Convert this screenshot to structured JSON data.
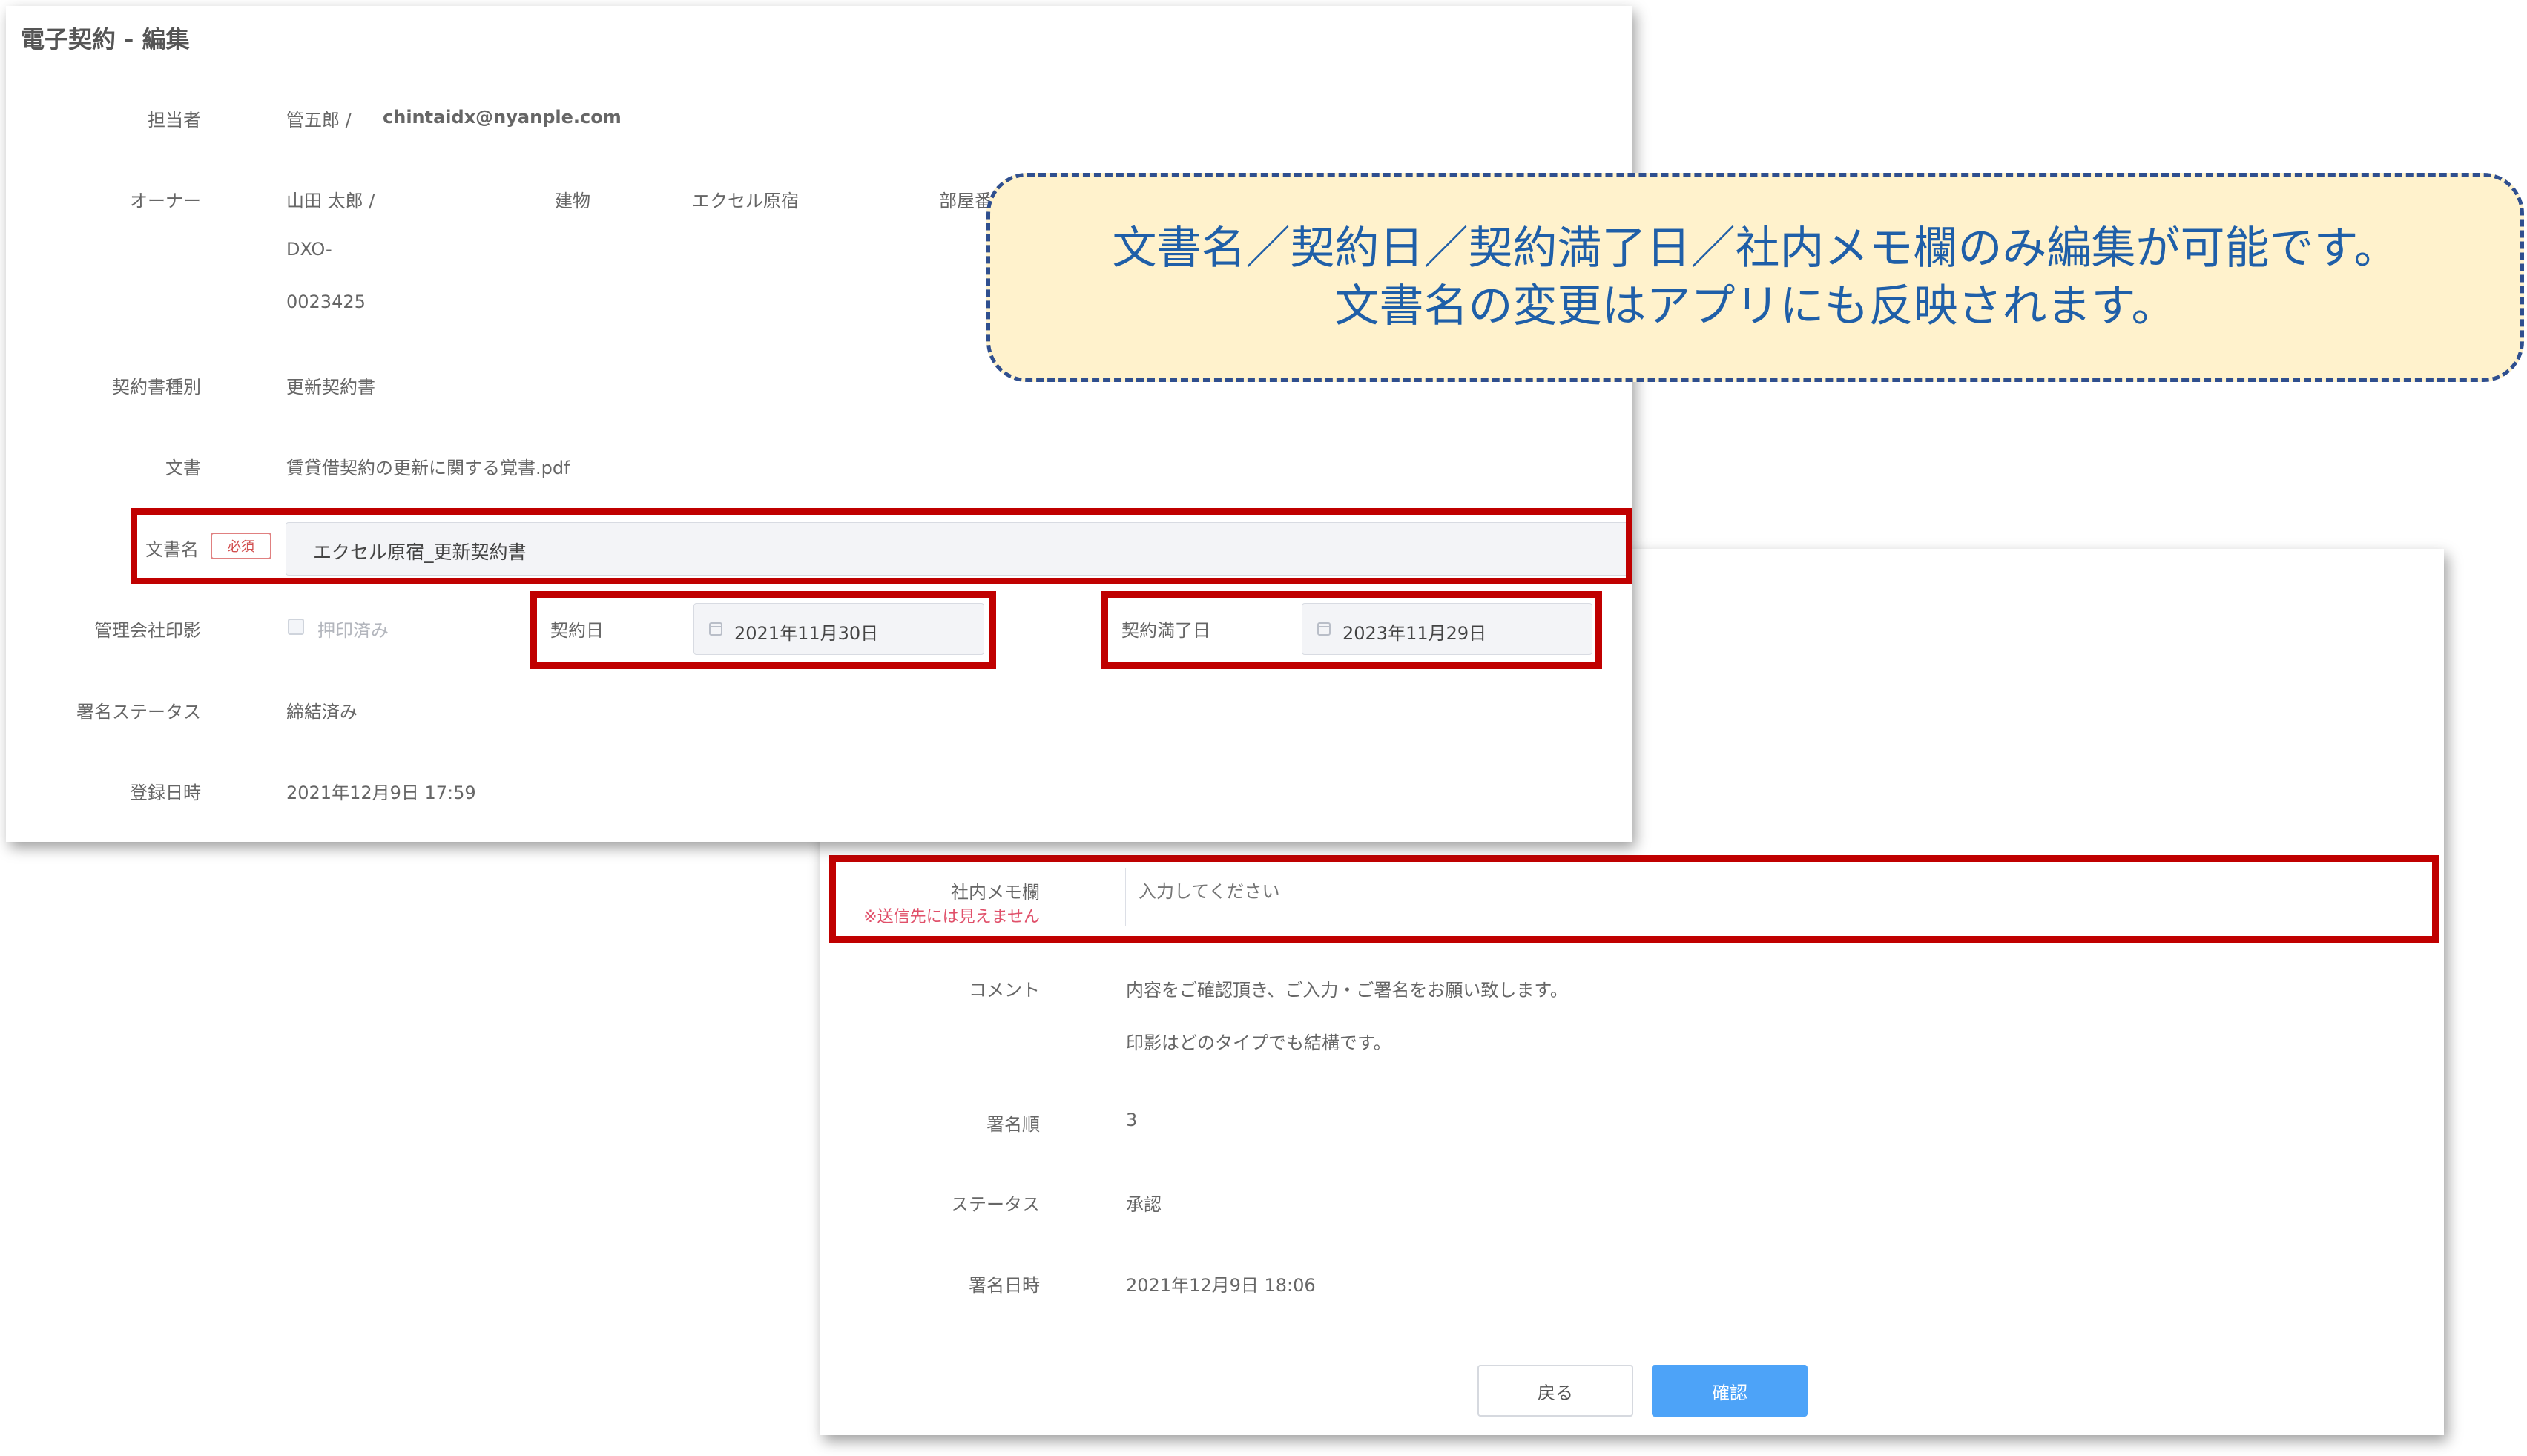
{
  "title": "電子契約 - 編集",
  "assignee": {
    "label": "担当者",
    "name": "管五郎 /",
    "email": "chintaidx@nyanple.com"
  },
  "owner": {
    "label": "オーナー",
    "name": "山田 太郎 /",
    "id_line1": "DXO-",
    "id_line2": "0023425"
  },
  "building": {
    "label": "建物",
    "value": "エクセル原宿"
  },
  "room": {
    "label": "部屋番"
  },
  "contract_type": {
    "label": "契約書種別",
    "value": "更新契約書"
  },
  "document": {
    "label": "文書",
    "value": "賃貸借契約の更新に関する覚書.pdf"
  },
  "doc_name": {
    "label": "文書名",
    "required_badge": "必須",
    "value": "エクセル原宿_更新契約書"
  },
  "seal": {
    "label": "管理会社印影",
    "checkbox_label": "押印済み"
  },
  "contract_date": {
    "label": "契約日",
    "value": "2021年11月30日"
  },
  "expiry_date": {
    "label": "契約満了日",
    "value": "2023年11月29日"
  },
  "sign_status": {
    "label": "署名ステータス",
    "value": "締結済み"
  },
  "registered": {
    "label": "登録日時",
    "value": "2021年12月9日 17:59"
  },
  "memo": {
    "label": "社内メモ欄",
    "note": "※送信先には見えません",
    "placeholder": "入力してください"
  },
  "comment": {
    "label": "コメント",
    "line1": "内容をご確認頂き、ご入力・ご署名をお願い致します。",
    "line2": "印影はどのタイプでも結構です。"
  },
  "sign_order": {
    "label": "署名順",
    "value": "3"
  },
  "status": {
    "label": "ステータス",
    "value": "承認"
  },
  "signed_at": {
    "label": "署名日時",
    "value": "2021年12月9日 18:06"
  },
  "buttons": {
    "back": "戻る",
    "confirm": "確認"
  },
  "callout": {
    "line1": "文書名／契約日／契約満了日／社内メモ欄のみ編集が可能です。",
    "line2": "文書名の変更はアプリにも反映されます。"
  },
  "colors": {
    "highlight": "#c00000",
    "primary": "#4da3f8",
    "callout_bg": "#fff2cc",
    "callout_border": "#2f4f8f",
    "callout_text": "#1f5fa8"
  }
}
